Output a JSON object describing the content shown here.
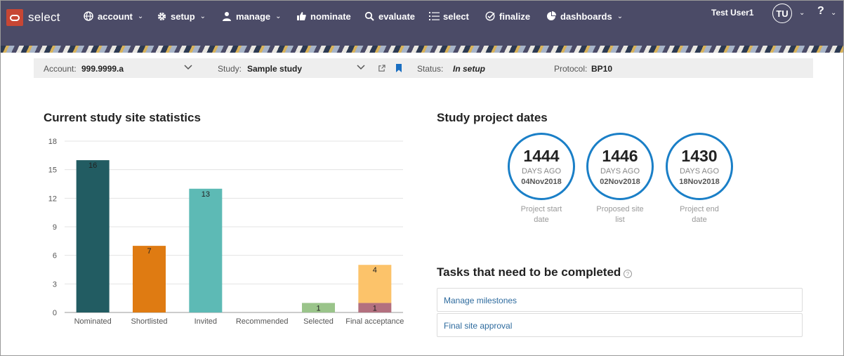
{
  "app": {
    "name": "select"
  },
  "nav": {
    "account": "account",
    "setup": "setup",
    "manage": "manage",
    "nominate": "nominate",
    "evaluate": "evaluate",
    "select": "select",
    "finalize": "finalize",
    "dashboards": "dashboards"
  },
  "user": {
    "name": "Test User1",
    "initials": "TU",
    "help": "?"
  },
  "context": {
    "account_label": "Account:",
    "account_value": "999.9999.a",
    "study_label": "Study:",
    "study_value": "Sample study",
    "status_label": "Status:",
    "status_value": "In setup",
    "protocol_label": "Protocol:",
    "protocol_value": "BP10"
  },
  "stats": {
    "title": "Current study site statistics"
  },
  "chart_data": {
    "type": "bar",
    "title": "Current study site statistics",
    "categories": [
      "Nominated",
      "Shortlisted",
      "Invited",
      "Recommended",
      "Selected",
      "Final acceptance"
    ],
    "series": [
      {
        "values": [
          16,
          7,
          13,
          0,
          1,
          1
        ],
        "colors": [
          "#225c62",
          "#df7b12",
          "#5dbab5",
          "#cccccc",
          "#9ac48a",
          "#b3707f"
        ]
      },
      {
        "values": [
          0,
          0,
          0,
          0,
          0,
          4
        ],
        "colors": [
          "#fcc36a",
          "#fcc36a",
          "#fcc36a",
          "#fcc36a",
          "#fcc36a",
          "#fcc36a"
        ]
      }
    ],
    "stacked": true,
    "yticks": [
      0,
      3,
      6,
      9,
      12,
      15,
      18
    ],
    "ylim": [
      0,
      18
    ],
    "grid": true
  },
  "dates": {
    "title": "Study project dates",
    "items": [
      {
        "number": "1444",
        "unit": "DAYS AGO",
        "date": "04Nov2018",
        "caption": "Project start date"
      },
      {
        "number": "1446",
        "unit": "DAYS AGO",
        "date": "02Nov2018",
        "caption": "Proposed site list"
      },
      {
        "number": "1430",
        "unit": "DAYS AGO",
        "date": "18Nov2018",
        "caption": "Project end date"
      }
    ]
  },
  "tasks": {
    "title": "Tasks that need to be completed",
    "items": [
      "Manage milestones",
      "Final site approval"
    ]
  },
  "colors": {
    "nav_bg": "#4b4b67",
    "accent": "#1a7fc7",
    "brand": "#c74634"
  }
}
